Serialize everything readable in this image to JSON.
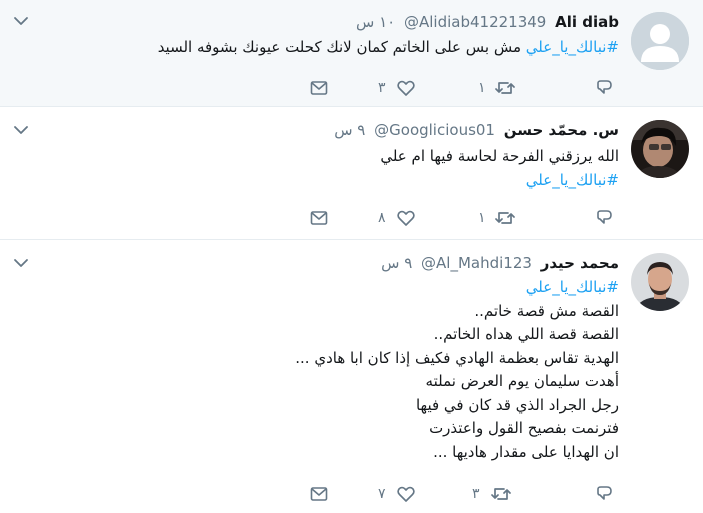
{
  "tweets": [
    {
      "name": "Ali diab",
      "handle": "@Alidiab41221349",
      "time": "١٠ س",
      "lines": [
        "مش بس على الخاتم كمان لانك كحلت عيونك بشوفه السيد"
      ],
      "hashtag": "#نبالك_يا_علي",
      "replies": "",
      "retweets": "١",
      "likes": "٣"
    },
    {
      "name": "س. محمّد حسن",
      "handle": "@Googlicious01",
      "time": "٩ س",
      "lines": [
        "الله يرزقني الفرحة لحاسة فيها ام علي"
      ],
      "hashtag": "#نبالك_يا_علي",
      "replies": "",
      "retweets": "١",
      "likes": "٨"
    },
    {
      "name": "محمد حيدر",
      "handle": "@Al_Mahdi123",
      "time": "٩ س",
      "hashtag": "#نبالك_يا_علي",
      "lines": [
        "القصة مش قصة خاتم..",
        "القصة قصة اللي هداه الخاتم..",
        "الهدية تقاس بعظمة الهادي فكيف إذا كان ابا هادي ...",
        "أهدت سليمان يوم العرض نملته",
        "رجل الجراد الذي قد كان في فيها",
        "فترنمت بفصيح القول واعتذرت",
        "ان الهدايا على  مقدار هاديها ..."
      ],
      "replies": "",
      "retweets": "٣",
      "likes": "٧"
    }
  ],
  "colors": {
    "accent": "#1da1f2",
    "muted": "#657786",
    "highlight_bg": "#f5f8fa",
    "border": "#e6ecf0"
  },
  "icons": [
    "chevron-down-icon",
    "reply-icon",
    "retweet-icon",
    "like-icon",
    "message-icon",
    "default-avatar-icon"
  ]
}
